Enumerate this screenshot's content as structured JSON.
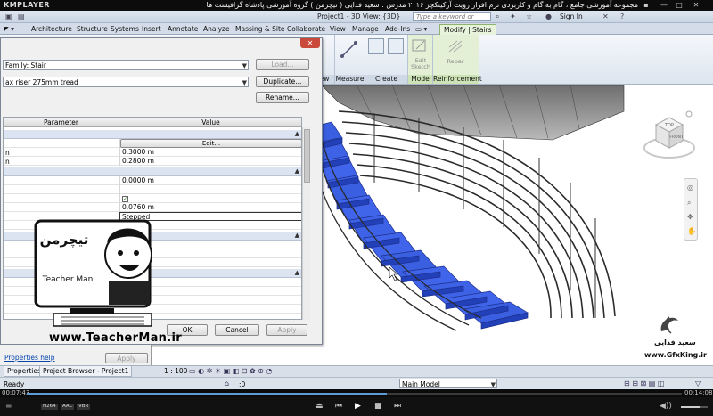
{
  "player": {
    "logo": "KMPLAYER",
    "video_title": "مجموعه آموزشی جامع ، گام به گام و کاربردی نرم افزار رویت آرکیتکچر ۲۰۱۶ مدرس : سعید فدایی ( تیچرمن ) گروه آموزشی پادشاه گرافیست ها",
    "time_elapsed": "00:07:43",
    "time_total": "00:14:08",
    "progress": 0.55,
    "badges": [
      "H264",
      "AAC",
      "VBR"
    ]
  },
  "revit": {
    "window_title": "Project1 - 3D View: {3D}",
    "search_placeholder": "Type a keyword or phrase",
    "sign_in": "Sign In",
    "tabs": [
      "Architecture",
      "Structure",
      "Systems",
      "Insert",
      "Annotate",
      "Analyze",
      "Massing & Site",
      "Collaborate",
      "View",
      "Manage",
      "Add-Ins"
    ],
    "active_tab": "Modify | Stairs",
    "panels": {
      "view": "View",
      "measure": "Measure",
      "create": "Create",
      "mode": "Mode",
      "reinforcement": "Reinforcement",
      "edit_sketch": "Edit Sketch",
      "rebar": "Rebar"
    },
    "viewcube": {
      "top": "TOP",
      "front": "FRONT"
    }
  },
  "dialog": {
    "family_label": "Family: Stair",
    "type_value": "ax riser 275mm tread",
    "load_btn": "Load...",
    "duplicate_btn": "Duplicate...",
    "rename_btn": "Rename...",
    "col_parameter": "Parameter",
    "col_value": "Value",
    "rows": {
      "r1_val": "Edit...",
      "r2_name": "n",
      "r2_val": "0.3000 m",
      "r3_name": "n",
      "r3_val": "0.2800 m",
      "r4_val": "0.0000 m",
      "r5_val": "0.0760 m",
      "r6_val": "Stepped"
    },
    "ok_btn": "OK",
    "cancel_btn": "Cancel",
    "apply_btn": "Apply"
  },
  "properties": {
    "help_link": "Properties help",
    "apply_btn": "Apply",
    "tab_properties": "Properties",
    "tab_project_browser": "Project Browser - Project1"
  },
  "status": {
    "text": "Ready",
    "scale": "1 : 100",
    "zero": ":0",
    "model": "Main Model"
  },
  "watermark": {
    "teacherman_site": "www.TeacherMan.ir",
    "logo_title": "تیچرمن",
    "logo_subtitle": "Teacher Man",
    "author_name": "سعید فدایی",
    "gfxking_site": "www.GfxKing.ir"
  }
}
